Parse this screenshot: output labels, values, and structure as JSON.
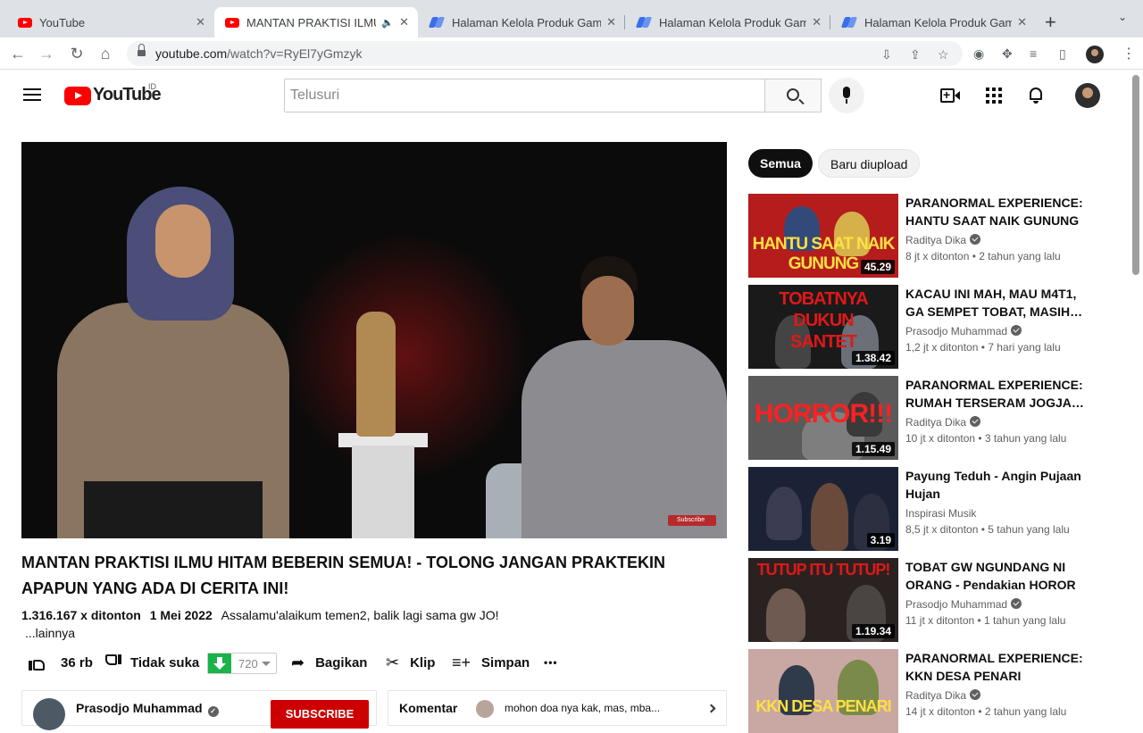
{
  "browser": {
    "tabs": [
      {
        "title": "YouTube",
        "favicon": "youtube-favicon",
        "active": false
      },
      {
        "title": "MANTAN PRAKTISI ILMU",
        "favicon": "youtube-favicon",
        "active": true,
        "audio": true
      },
      {
        "title": "Halaman Kelola Produk Game",
        "favicon": "workspace-favicon",
        "active": false
      },
      {
        "title": "Halaman Kelola Produk Game",
        "favicon": "workspace-favicon",
        "active": false
      },
      {
        "title": "Halaman Kelola Produk Game",
        "favicon": "workspace-favicon",
        "active": false
      }
    ],
    "url_host": "youtube.com",
    "url_path": "/watch?v=RyEl7yGmzyk"
  },
  "youtube": {
    "logo": "YouTube",
    "country": "ID",
    "search_placeholder": "Telusuri"
  },
  "video": {
    "title": "MANTAN PRAKTISI ILMU HITAM BEBERIN SEMUA! - TOLONG JANGAN PRAKTEKIN APAPUN YANG ADA DI CERITA INI!",
    "views": "1.316.167 x ditonton",
    "date": "1 Mei 2022",
    "description": "Assalamu'alaikum temen2, balik lagi sama gw JO!",
    "more": "...lainnya",
    "likes": "36 rb",
    "dislike_label": "Tidak suka",
    "download_quality": "720",
    "share_label": "Bagikan",
    "clip_label": "Klip",
    "save_label": "Simpan",
    "more_actions": "•••",
    "watermark": "Subscribe"
  },
  "channel": {
    "name": "Prasodjo Muhammad",
    "subscribe_label": "SUBSCRIBE"
  },
  "comments": {
    "label": "Komentar",
    "preview": "mohon doa nya kak, mas, mba..."
  },
  "chips": [
    "Semua",
    "Baru diupload"
  ],
  "recommendations": [
    {
      "title": "PARANORMAL EXPERIENCE: HANTU SAAT NAIK GUNUNG",
      "channel": "Raditya Dika",
      "stats": "8 jt x ditonton • 2 tahun yang lalu",
      "duration": "45.29",
      "thumb_caption": "HANTU SAAT NAIK GUNUNG",
      "thumb_bg": "#b51d1d"
    },
    {
      "title": "KACAU INI MAH, MAU M4T1, GA SEMPET TOBAT, MASIH…",
      "channel": "Prasodjo Muhammad",
      "stats": "1,2 jt x ditonton • 7 hari yang lalu",
      "duration": "1.38.42",
      "thumb_caption": "TOBATNYA DUKUN SANTET",
      "thumb_bg": "#1a1a1a"
    },
    {
      "title": "PARANORMAL EXPERIENCE: RUMAH TERSERAM JOGJA…",
      "channel": "Raditya Dika",
      "stats": "10 jt x ditonton • 3 tahun yang lalu",
      "duration": "1.15.49",
      "thumb_caption": "HORROR!!!",
      "thumb_bg": "#5a5a5a"
    },
    {
      "title": "Payung Teduh - Angin Pujaan Hujan",
      "channel": "Inspirasi Musik",
      "stats": "8,5 jt x ditonton • 5 tahun yang lalu",
      "duration": "3.19",
      "thumb_caption": "",
      "thumb_bg": "#1c2236"
    },
    {
      "title": "TOBAT GW NGUNDANG NI ORANG - Pendakian HOROR G…",
      "channel": "Prasodjo Muhammad",
      "stats": "11 jt x ditonton • 1 tahun yang lalu",
      "duration": "1.19.34",
      "thumb_caption": "TUTUP ITU TUTUP!",
      "thumb_bg": "#2a2220"
    },
    {
      "title": "PARANORMAL EXPERIENCE: KKN DESA PENARI",
      "channel": "Raditya Dika",
      "stats": "14 jt x ditonton • 2 tahun yang lalu",
      "duration": "",
      "thumb_caption": "KKN DESA PENARI",
      "thumb_bg": "#c9a7a2"
    }
  ],
  "colors": {
    "youtube_red": "#ff0000",
    "subscribe_red": "#cc0000",
    "download_green": "#19b34a"
  }
}
